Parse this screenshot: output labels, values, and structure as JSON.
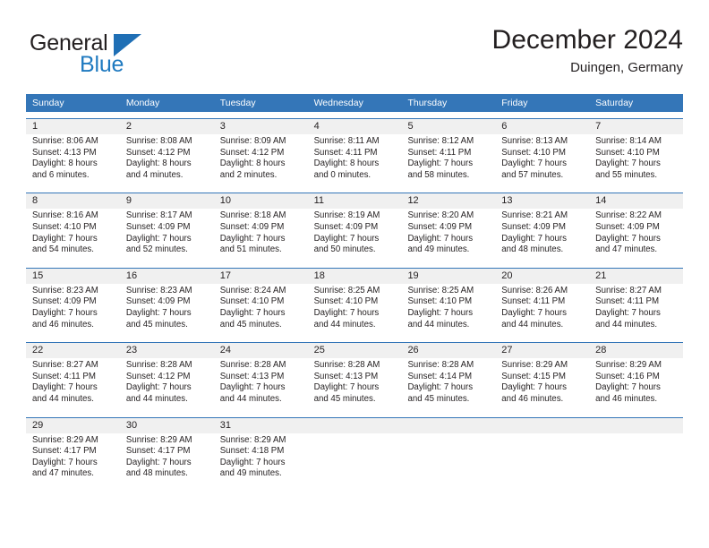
{
  "brand": {
    "name_part1": "General",
    "name_part2": "Blue",
    "accent_color": "#1f7ac0",
    "header_color": "#3476b8"
  },
  "header": {
    "title": "December 2024",
    "subtitle": "Duingen, Germany"
  },
  "calendar": {
    "weekday_headers": [
      "Sunday",
      "Monday",
      "Tuesday",
      "Wednesday",
      "Thursday",
      "Friday",
      "Saturday"
    ],
    "weeks": [
      [
        {
          "day": "1",
          "sunrise": "Sunrise: 8:06 AM",
          "sunset": "Sunset: 4:13 PM",
          "daylight1": "Daylight: 8 hours",
          "daylight2": "and 6 minutes."
        },
        {
          "day": "2",
          "sunrise": "Sunrise: 8:08 AM",
          "sunset": "Sunset: 4:12 PM",
          "daylight1": "Daylight: 8 hours",
          "daylight2": "and 4 minutes."
        },
        {
          "day": "3",
          "sunrise": "Sunrise: 8:09 AM",
          "sunset": "Sunset: 4:12 PM",
          "daylight1": "Daylight: 8 hours",
          "daylight2": "and 2 minutes."
        },
        {
          "day": "4",
          "sunrise": "Sunrise: 8:11 AM",
          "sunset": "Sunset: 4:11 PM",
          "daylight1": "Daylight: 8 hours",
          "daylight2": "and 0 minutes."
        },
        {
          "day": "5",
          "sunrise": "Sunrise: 8:12 AM",
          "sunset": "Sunset: 4:11 PM",
          "daylight1": "Daylight: 7 hours",
          "daylight2": "and 58 minutes."
        },
        {
          "day": "6",
          "sunrise": "Sunrise: 8:13 AM",
          "sunset": "Sunset: 4:10 PM",
          "daylight1": "Daylight: 7 hours",
          "daylight2": "and 57 minutes."
        },
        {
          "day": "7",
          "sunrise": "Sunrise: 8:14 AM",
          "sunset": "Sunset: 4:10 PM",
          "daylight1": "Daylight: 7 hours",
          "daylight2": "and 55 minutes."
        }
      ],
      [
        {
          "day": "8",
          "sunrise": "Sunrise: 8:16 AM",
          "sunset": "Sunset: 4:10 PM",
          "daylight1": "Daylight: 7 hours",
          "daylight2": "and 54 minutes."
        },
        {
          "day": "9",
          "sunrise": "Sunrise: 8:17 AM",
          "sunset": "Sunset: 4:09 PM",
          "daylight1": "Daylight: 7 hours",
          "daylight2": "and 52 minutes."
        },
        {
          "day": "10",
          "sunrise": "Sunrise: 8:18 AM",
          "sunset": "Sunset: 4:09 PM",
          "daylight1": "Daylight: 7 hours",
          "daylight2": "and 51 minutes."
        },
        {
          "day": "11",
          "sunrise": "Sunrise: 8:19 AM",
          "sunset": "Sunset: 4:09 PM",
          "daylight1": "Daylight: 7 hours",
          "daylight2": "and 50 minutes."
        },
        {
          "day": "12",
          "sunrise": "Sunrise: 8:20 AM",
          "sunset": "Sunset: 4:09 PM",
          "daylight1": "Daylight: 7 hours",
          "daylight2": "and 49 minutes."
        },
        {
          "day": "13",
          "sunrise": "Sunrise: 8:21 AM",
          "sunset": "Sunset: 4:09 PM",
          "daylight1": "Daylight: 7 hours",
          "daylight2": "and 48 minutes."
        },
        {
          "day": "14",
          "sunrise": "Sunrise: 8:22 AM",
          "sunset": "Sunset: 4:09 PM",
          "daylight1": "Daylight: 7 hours",
          "daylight2": "and 47 minutes."
        }
      ],
      [
        {
          "day": "15",
          "sunrise": "Sunrise: 8:23 AM",
          "sunset": "Sunset: 4:09 PM",
          "daylight1": "Daylight: 7 hours",
          "daylight2": "and 46 minutes."
        },
        {
          "day": "16",
          "sunrise": "Sunrise: 8:23 AM",
          "sunset": "Sunset: 4:09 PM",
          "daylight1": "Daylight: 7 hours",
          "daylight2": "and 45 minutes."
        },
        {
          "day": "17",
          "sunrise": "Sunrise: 8:24 AM",
          "sunset": "Sunset: 4:10 PM",
          "daylight1": "Daylight: 7 hours",
          "daylight2": "and 45 minutes."
        },
        {
          "day": "18",
          "sunrise": "Sunrise: 8:25 AM",
          "sunset": "Sunset: 4:10 PM",
          "daylight1": "Daylight: 7 hours",
          "daylight2": "and 44 minutes."
        },
        {
          "day": "19",
          "sunrise": "Sunrise: 8:25 AM",
          "sunset": "Sunset: 4:10 PM",
          "daylight1": "Daylight: 7 hours",
          "daylight2": "and 44 minutes."
        },
        {
          "day": "20",
          "sunrise": "Sunrise: 8:26 AM",
          "sunset": "Sunset: 4:11 PM",
          "daylight1": "Daylight: 7 hours",
          "daylight2": "and 44 minutes."
        },
        {
          "day": "21",
          "sunrise": "Sunrise: 8:27 AM",
          "sunset": "Sunset: 4:11 PM",
          "daylight1": "Daylight: 7 hours",
          "daylight2": "and 44 minutes."
        }
      ],
      [
        {
          "day": "22",
          "sunrise": "Sunrise: 8:27 AM",
          "sunset": "Sunset: 4:11 PM",
          "daylight1": "Daylight: 7 hours",
          "daylight2": "and 44 minutes."
        },
        {
          "day": "23",
          "sunrise": "Sunrise: 8:28 AM",
          "sunset": "Sunset: 4:12 PM",
          "daylight1": "Daylight: 7 hours",
          "daylight2": "and 44 minutes."
        },
        {
          "day": "24",
          "sunrise": "Sunrise: 8:28 AM",
          "sunset": "Sunset: 4:13 PM",
          "daylight1": "Daylight: 7 hours",
          "daylight2": "and 44 minutes."
        },
        {
          "day": "25",
          "sunrise": "Sunrise: 8:28 AM",
          "sunset": "Sunset: 4:13 PM",
          "daylight1": "Daylight: 7 hours",
          "daylight2": "and 45 minutes."
        },
        {
          "day": "26",
          "sunrise": "Sunrise: 8:28 AM",
          "sunset": "Sunset: 4:14 PM",
          "daylight1": "Daylight: 7 hours",
          "daylight2": "and 45 minutes."
        },
        {
          "day": "27",
          "sunrise": "Sunrise: 8:29 AM",
          "sunset": "Sunset: 4:15 PM",
          "daylight1": "Daylight: 7 hours",
          "daylight2": "and 46 minutes."
        },
        {
          "day": "28",
          "sunrise": "Sunrise: 8:29 AM",
          "sunset": "Sunset: 4:16 PM",
          "daylight1": "Daylight: 7 hours",
          "daylight2": "and 46 minutes."
        }
      ],
      [
        {
          "day": "29",
          "sunrise": "Sunrise: 8:29 AM",
          "sunset": "Sunset: 4:17 PM",
          "daylight1": "Daylight: 7 hours",
          "daylight2": "and 47 minutes."
        },
        {
          "day": "30",
          "sunrise": "Sunrise: 8:29 AM",
          "sunset": "Sunset: 4:17 PM",
          "daylight1": "Daylight: 7 hours",
          "daylight2": "and 48 minutes."
        },
        {
          "day": "31",
          "sunrise": "Sunrise: 8:29 AM",
          "sunset": "Sunset: 4:18 PM",
          "daylight1": "Daylight: 7 hours",
          "daylight2": "and 49 minutes."
        },
        {
          "day": "",
          "sunrise": "",
          "sunset": "",
          "daylight1": "",
          "daylight2": ""
        },
        {
          "day": "",
          "sunrise": "",
          "sunset": "",
          "daylight1": "",
          "daylight2": ""
        },
        {
          "day": "",
          "sunrise": "",
          "sunset": "",
          "daylight1": "",
          "daylight2": ""
        },
        {
          "day": "",
          "sunrise": "",
          "sunset": "",
          "daylight1": "",
          "daylight2": ""
        }
      ]
    ]
  }
}
